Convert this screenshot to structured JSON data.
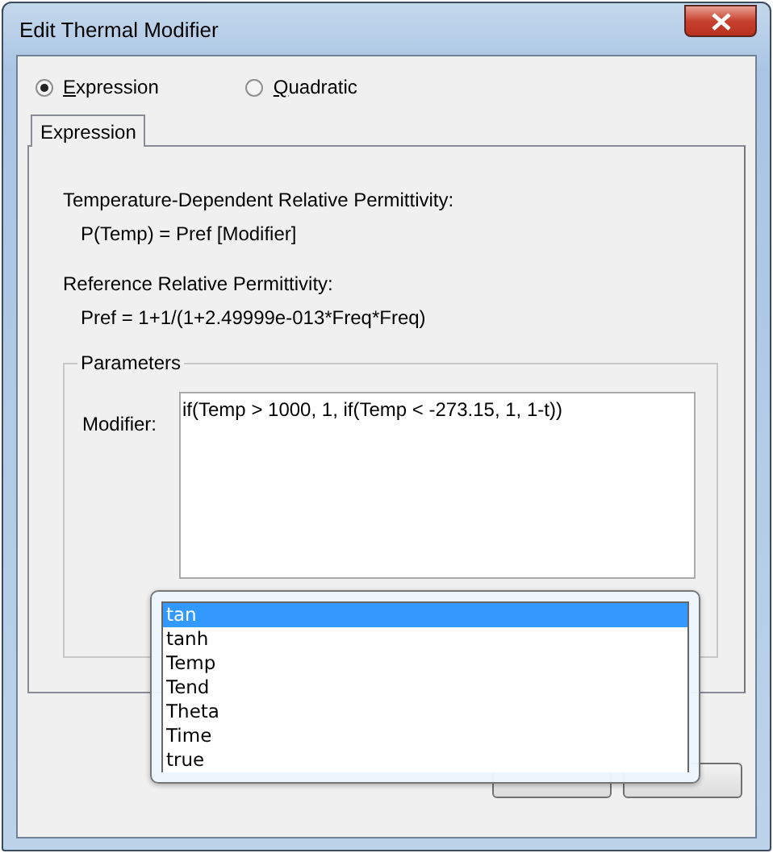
{
  "window": {
    "title": "Edit Thermal Modifier"
  },
  "modes": [
    {
      "label": "Expression",
      "selected": true
    },
    {
      "label": "Quadratic",
      "selected": false
    }
  ],
  "tabs": [
    {
      "label": "Expression",
      "selected": true
    }
  ],
  "formula_heading": "Temperature-Dependent Relative Permittivity:",
  "formula": "P(Temp) = Pref [Modifier]",
  "reference_heading": "Reference Relative Permittivity:",
  "reference": "Pref = 1+1/(1+2.49999e-013*Freq*Freq)",
  "parameters": {
    "title": "Parameters",
    "modifier_label": "Modifier:",
    "modifier_value": "if(Temp > 1000, 1, if(Temp < -273.15, 1, 1-t))"
  },
  "autocomplete": [
    {
      "label": "tan",
      "selected": true
    },
    {
      "label": "tanh",
      "selected": false
    },
    {
      "label": "Temp",
      "selected": false
    },
    {
      "label": "Tend",
      "selected": false
    },
    {
      "label": "Theta",
      "selected": false
    },
    {
      "label": "Time",
      "selected": false
    },
    {
      "label": "true",
      "selected": false
    }
  ]
}
